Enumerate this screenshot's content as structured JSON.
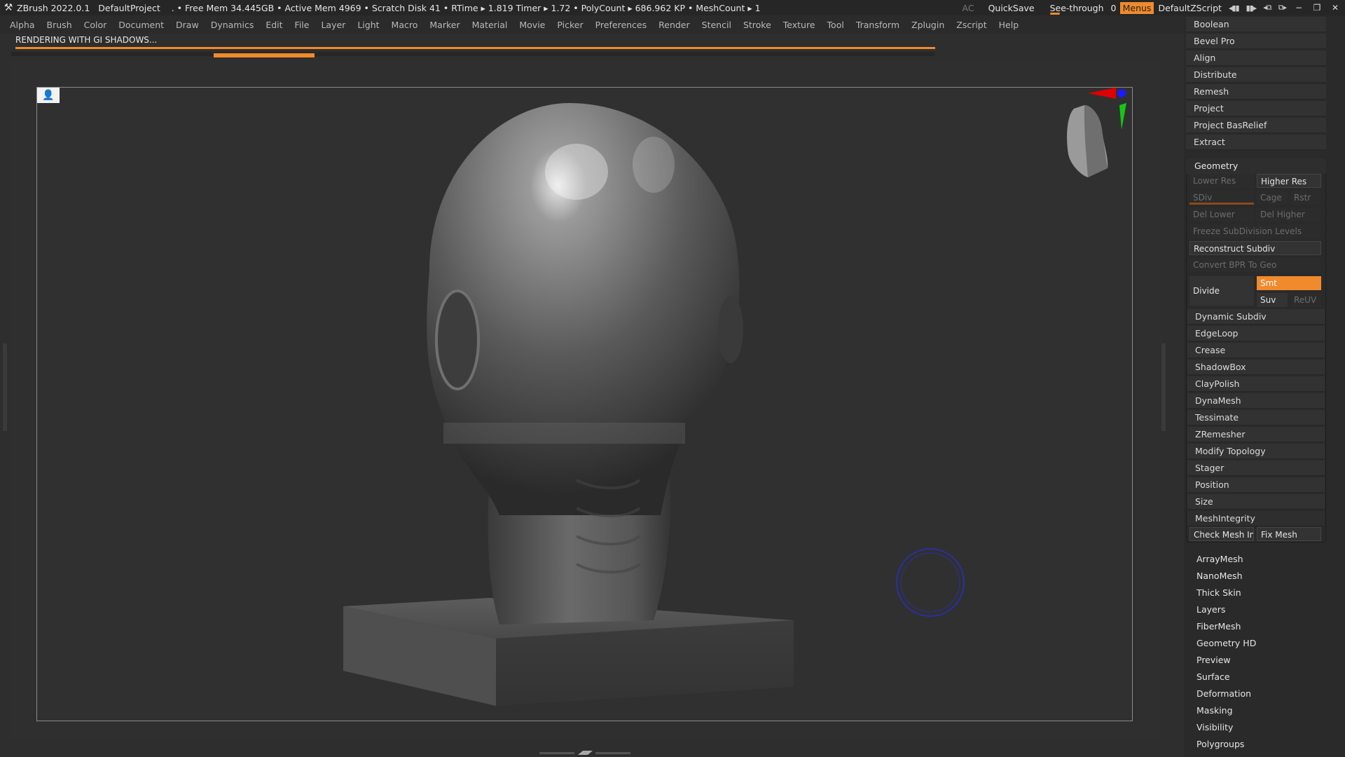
{
  "titlebar": {
    "app": "ZBrush 2022.0.1",
    "project": "DefaultProject",
    "stats": ". • Free Mem 34.445GB • Active Mem 4969 • Scratch Disk 41 •  RTime ▸ 1.819 Timer ▸ 1.72 • PolyCount ▸ 686.962 KP  • MeshCount ▸ 1",
    "ac": "AC",
    "quicksave": "QuickSave",
    "see_through_label": "See-through",
    "see_through_value": "0",
    "menus": "Menus",
    "zscript": "DefaultZScript"
  },
  "menubar": [
    "Alpha",
    "Brush",
    "Color",
    "Document",
    "Draw",
    "Dynamics",
    "Edit",
    "File",
    "Layer",
    "Light",
    "Macro",
    "Marker",
    "Material",
    "Movie",
    "Picker",
    "Preferences",
    "Render",
    "Stencil",
    "Stroke",
    "Texture",
    "Tool",
    "Transform",
    "Zplugin",
    "Zscript",
    "Help"
  ],
  "render": {
    "status": "RENDERING WITH GI SHADOWS..."
  },
  "panel": {
    "top_buttons": [
      "Boolean",
      "Bevel Pro",
      "Align",
      "Distribute",
      "Remesh",
      "Project",
      "Project BasRelief",
      "Extract"
    ],
    "geometry": {
      "title": "Geometry",
      "lower_res": "Lower Res",
      "higher_res": "Higher Res",
      "sdiv": "SDiv",
      "cage": "Cage",
      "rstr": "Rstr",
      "del_lower": "Del Lower",
      "del_higher": "Del Higher",
      "freeze": "Freeze SubDivision Levels",
      "reconstruct": "Reconstruct Subdiv",
      "convert_bpr": "Convert BPR To Geo",
      "divide": "Divide",
      "smt": "Smt",
      "suv": "Suv",
      "reuv": "ReUV",
      "sub_items": [
        "Dynamic Subdiv",
        "EdgeLoop",
        "Crease",
        "ShadowBox",
        "ClayPolish",
        "DynaMesh",
        "Tessimate",
        "ZRemesher",
        "Modify Topology",
        "Stager",
        "Position",
        "Size"
      ],
      "mesh_integrity": "MeshIntegrity",
      "check_mesh": "Check Mesh Inte",
      "fix_mesh": "Fix Mesh"
    },
    "lower_items": [
      "ArrayMesh",
      "NanoMesh",
      "Thick Skin",
      "Layers",
      "FiberMesh",
      "Geometry HD",
      "Preview",
      "Surface",
      "Deformation",
      "Masking",
      "Visibility",
      "Polygroups"
    ]
  },
  "colors": {
    "accent": "#f08a2c",
    "background": "#2e2e2e"
  }
}
